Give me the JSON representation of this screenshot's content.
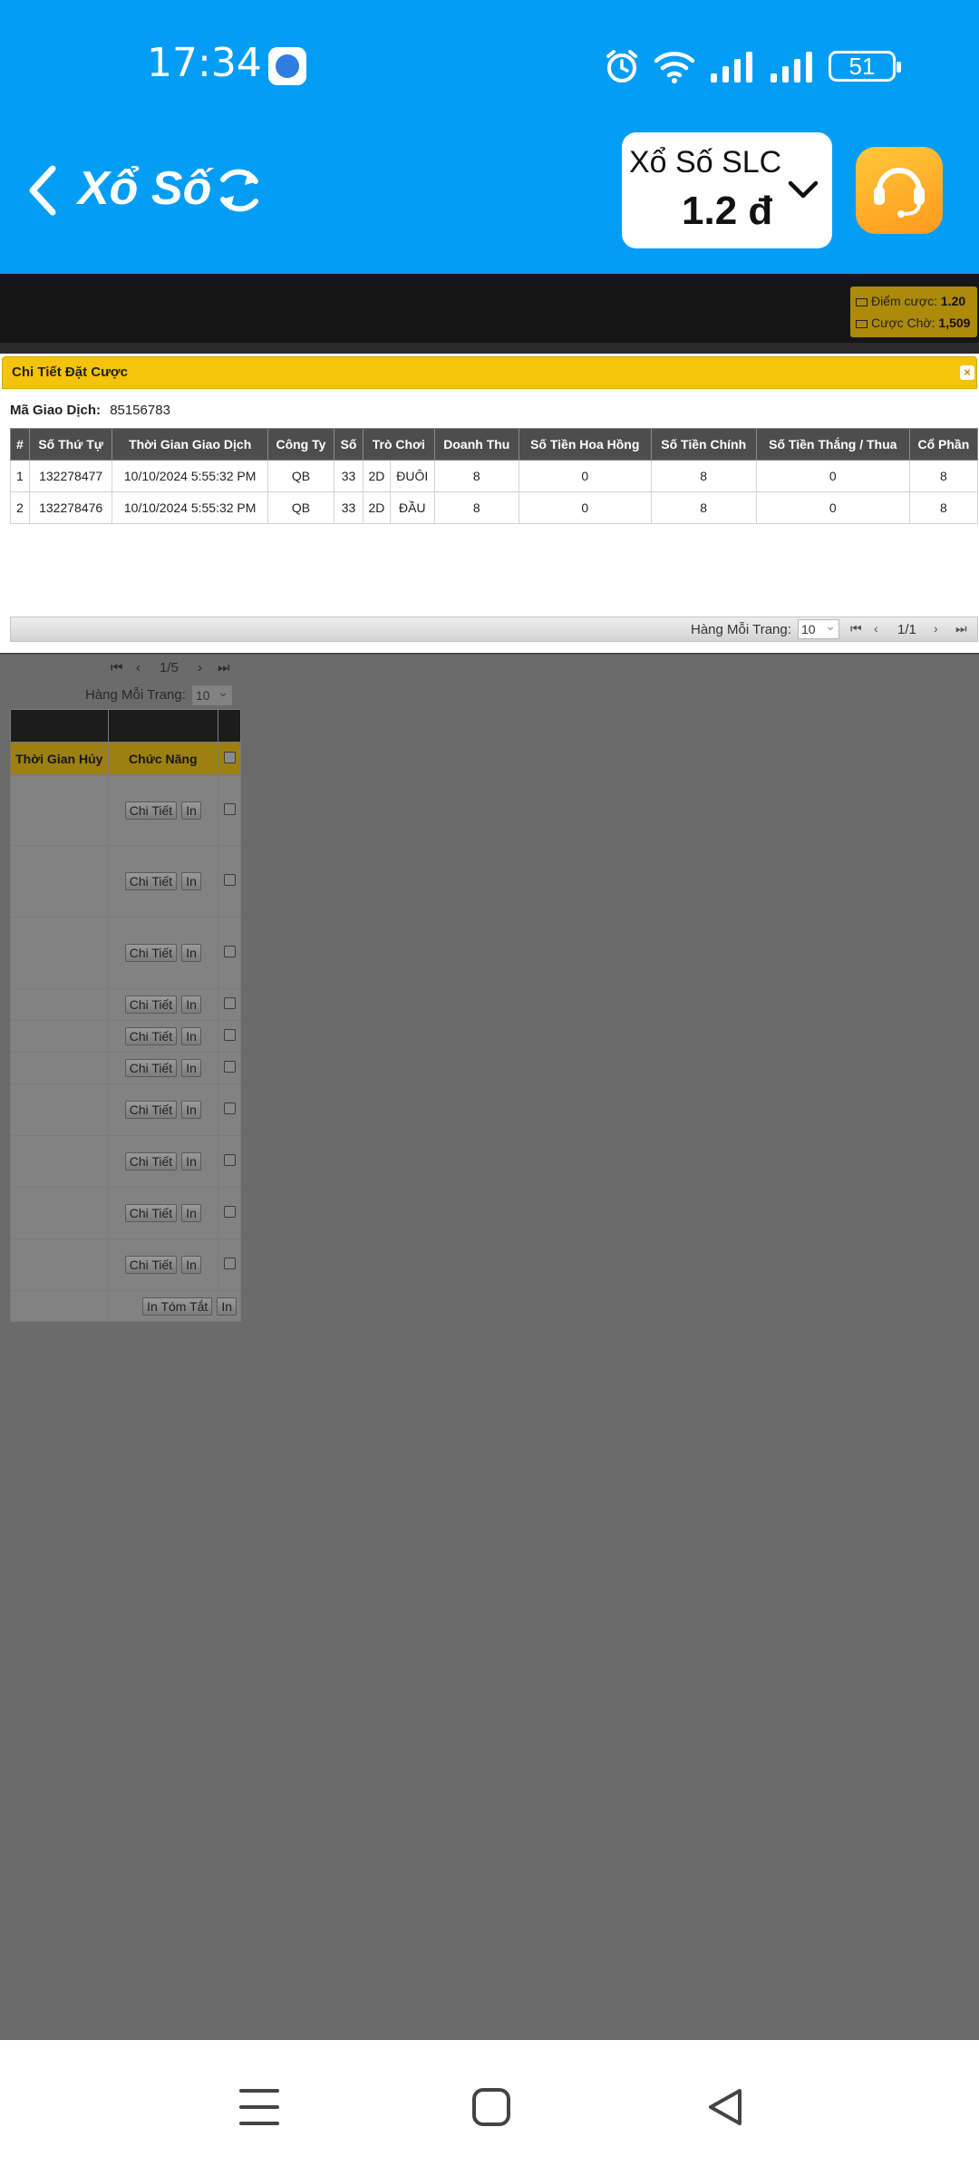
{
  "status_bar": {
    "time": "17:34",
    "battery": "51",
    "icons": [
      "app-icon",
      "alarm-icon",
      "wifi-icon",
      "signal-icon",
      "signal-icon",
      "battery-icon"
    ]
  },
  "header": {
    "title": "Xổ Số",
    "lottery_name": "Xổ Số SLC",
    "balance": "1.2 đ",
    "colors": {
      "bar": "#049df5",
      "support": "#ffb02e"
    }
  },
  "points": {
    "bet_points_label": "Điểm cược:",
    "bet_points_value": "1.20",
    "pending_label": "Cược Chờ:",
    "pending_value": "1,509"
  },
  "modal": {
    "title": "Chi Tiết Đặt Cược",
    "close_label": "×",
    "transaction_label": "Mã Giao Dịch:",
    "transaction_id": "85156783",
    "columns": [
      "#",
      "Số Thứ Tự",
      "Thời Gian Giao Dịch",
      "Công Ty",
      "Số",
      "Trò Chơi",
      "",
      "Doanh Thu",
      "Số Tiền Hoa Hồng",
      "Số Tiền Chính",
      "Số Tiền Thắng / Thua",
      "Cổ Phần"
    ],
    "rows": [
      [
        "1",
        "132278477",
        "10/10/2024 5:55:32 PM",
        "QB",
        "33",
        "2D",
        "ĐUÔI",
        "8",
        "0",
        "8",
        "0",
        "8"
      ],
      [
        "2",
        "132278476",
        "10/10/2024 5:55:32 PM",
        "QB",
        "33",
        "2D",
        "ĐẦU",
        "8",
        "0",
        "8",
        "0",
        "8"
      ]
    ],
    "pager": {
      "rows_label": "Hàng Mỗi Trang:",
      "rows_value": "10",
      "first": "⏮",
      "prev": "‹",
      "page": "1/1",
      "next": "›",
      "last": "⏭"
    }
  },
  "background_list": {
    "pager": {
      "first": "⏮",
      "prev": "‹",
      "page": "1/5",
      "next": "›",
      "last": "⏭"
    },
    "rows_label": "Hàng Mỗi Trang:",
    "rows_value": "10",
    "col_cancel_time": "Thời Gian Hủy",
    "col_function": "Chức Năng",
    "detail_label": "Chi Tiết",
    "print_label": "In",
    "summary_label": "In Tóm Tắt",
    "summary_print_label": "In"
  },
  "nav": {
    "icons": [
      "menu-icon",
      "home-icon",
      "back-icon"
    ]
  }
}
